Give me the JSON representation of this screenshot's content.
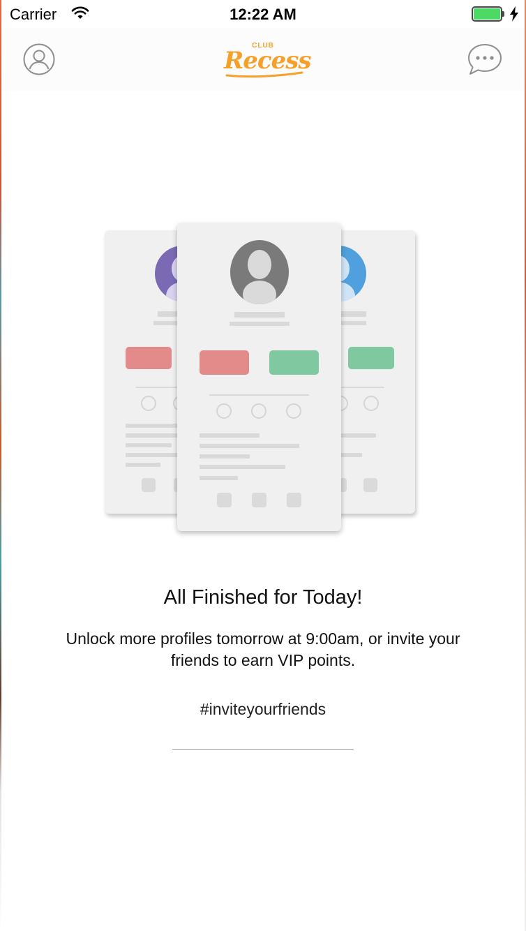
{
  "status_bar": {
    "carrier": "Carrier",
    "time": "12:22 AM",
    "battery_level": 1.0
  },
  "nav": {
    "logo_small": "CLUB",
    "logo_main": "Recess",
    "left_icon": "profile-icon",
    "right_icon": "chat-bubble-icon"
  },
  "message": {
    "title": "All Finished for Today!",
    "body": "Unlock more profiles tomorrow at 9:00am, or invite your friends to earn VIP points.",
    "hashtag": "#inviteyourfriends"
  },
  "colors": {
    "brand": "#f5a02a",
    "reject": "#e38b8b",
    "accept": "#7fc8a0",
    "avatar_left": "#7b6ab3",
    "avatar_right": "#4fa0dd",
    "avatar_front": "#7a7a7a"
  }
}
